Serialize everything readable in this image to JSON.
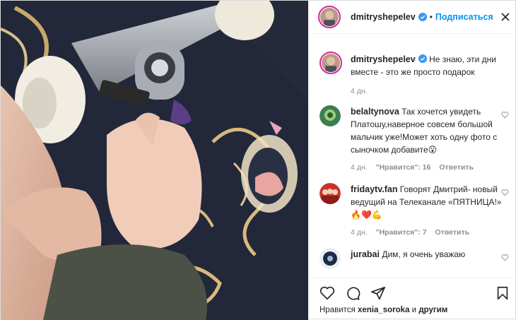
{
  "header": {
    "username": "dmitryshepelev",
    "separator": "•",
    "follow_label": "Подписаться"
  },
  "caption": {
    "username": "dmitryshepelev",
    "text": "Не знаю, эти дни вместе - это же просто подарок",
    "time": "4 дн."
  },
  "comments": [
    {
      "username": "belaltynova",
      "text": "Так хочется увидеть Платошу,наверное совсем большой мальчик уже!Может хоть одну фото с сыночком добавите😮",
      "time": "4 дн.",
      "likes": "\"Нравится\": 16",
      "reply": "Ответить"
    },
    {
      "username": "fridaytv.fan",
      "text": "Говорят Дмитрий- новый ведущий на Телеканале «ПЯТНИЦА!» 🔥❤️💪",
      "time": "4 дн.",
      "likes": "\"Нравится\": 7",
      "reply": "Ответить"
    },
    {
      "username": "jurabai",
      "text": "Дим, я очень уважаю"
    }
  ],
  "likes_line": {
    "prefix": "Нравится",
    "user": "xenia_soroka",
    "suffix": "и другим"
  },
  "colors": {
    "accent": "#0095f6",
    "verified": "#3897f0",
    "muted": "#8e8e8e"
  },
  "icons": [
    "verified-badge-icon",
    "more-options-icon",
    "heart-icon",
    "comment-icon",
    "share-icon",
    "bookmark-icon"
  ]
}
